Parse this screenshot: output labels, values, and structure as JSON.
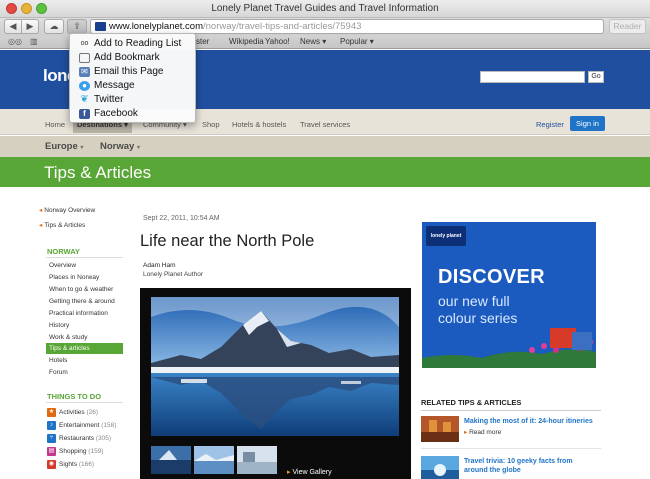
{
  "window": {
    "title": "Lonely Planet Travel Guides and Travel Information",
    "address_domain": "www.lonelyplanet.com",
    "address_path": "/norway/travel-tips-and-articles/75943",
    "reader_label": "Reader"
  },
  "bookmarks": [
    "ster",
    "Wikipedia",
    "Yahoo!",
    "News ▾",
    "Popular ▾"
  ],
  "share_menu": [
    {
      "label": "Add to Reading List",
      "icon": "glasses-icon"
    },
    {
      "label": "Add Bookmark",
      "icon": "book-icon"
    },
    {
      "label": "Email this Page",
      "icon": "mail-icon"
    },
    {
      "label": "Message",
      "icon": "message-icon"
    },
    {
      "label": "Twitter",
      "icon": "twitter-icon"
    },
    {
      "label": "Facebook",
      "icon": "facebook-icon"
    }
  ],
  "header": {
    "logo": "lonely",
    "go_label": "Go"
  },
  "nav": {
    "items": [
      "Home",
      "Destinations ▾",
      "Community ▾",
      "Shop",
      "Hotels & hostels",
      "Travel services"
    ],
    "register": "Register",
    "signin": "Sign in"
  },
  "crumbs": [
    "Europe",
    "Norway"
  ],
  "section_title": "Tips & Articles",
  "sidebar": {
    "links": [
      "Norway Overview",
      "Tips & Articles"
    ],
    "norway_head": "NORWAY",
    "norway_items": [
      "Overview",
      "Places in Norway",
      "When to go & weather",
      "Getting there & around",
      "Practical information",
      "History",
      "Work & study",
      "Tips & articles",
      "Hotels",
      "Forum"
    ],
    "things_head": "THINGS TO DO",
    "things_items": [
      {
        "label": "Activities",
        "count": "(26)",
        "color": "#e06a10"
      },
      {
        "label": "Entertainment",
        "count": "(158)",
        "color": "#1f74c7"
      },
      {
        "label": "Restaurants",
        "count": "(305)",
        "color": "#1f74c7"
      },
      {
        "label": "Shopping",
        "count": "(159)",
        "color": "#c0398a"
      },
      {
        "label": "Sights",
        "count": "(166)",
        "color": "#d83a2a"
      }
    ]
  },
  "article": {
    "date": "Sept 22, 2011, 10:54 AM",
    "title": "Life near the North Pole",
    "author": "Adam Ham",
    "author_role": "Lonely Planet Author",
    "view_gallery": "View Gallery"
  },
  "ad": {
    "logo": "lonely planet",
    "line1": "DISCOVER",
    "line2": "our new full",
    "line3": "colour series"
  },
  "related": {
    "heading": "RELATED TIPS & ARTICLES",
    "items": [
      {
        "title": "Making the most of it: 24-hour itineries",
        "more": "Read more"
      },
      {
        "title": "Travel trivia: 10 geeky facts from around the globe",
        "more": ""
      }
    ]
  }
}
